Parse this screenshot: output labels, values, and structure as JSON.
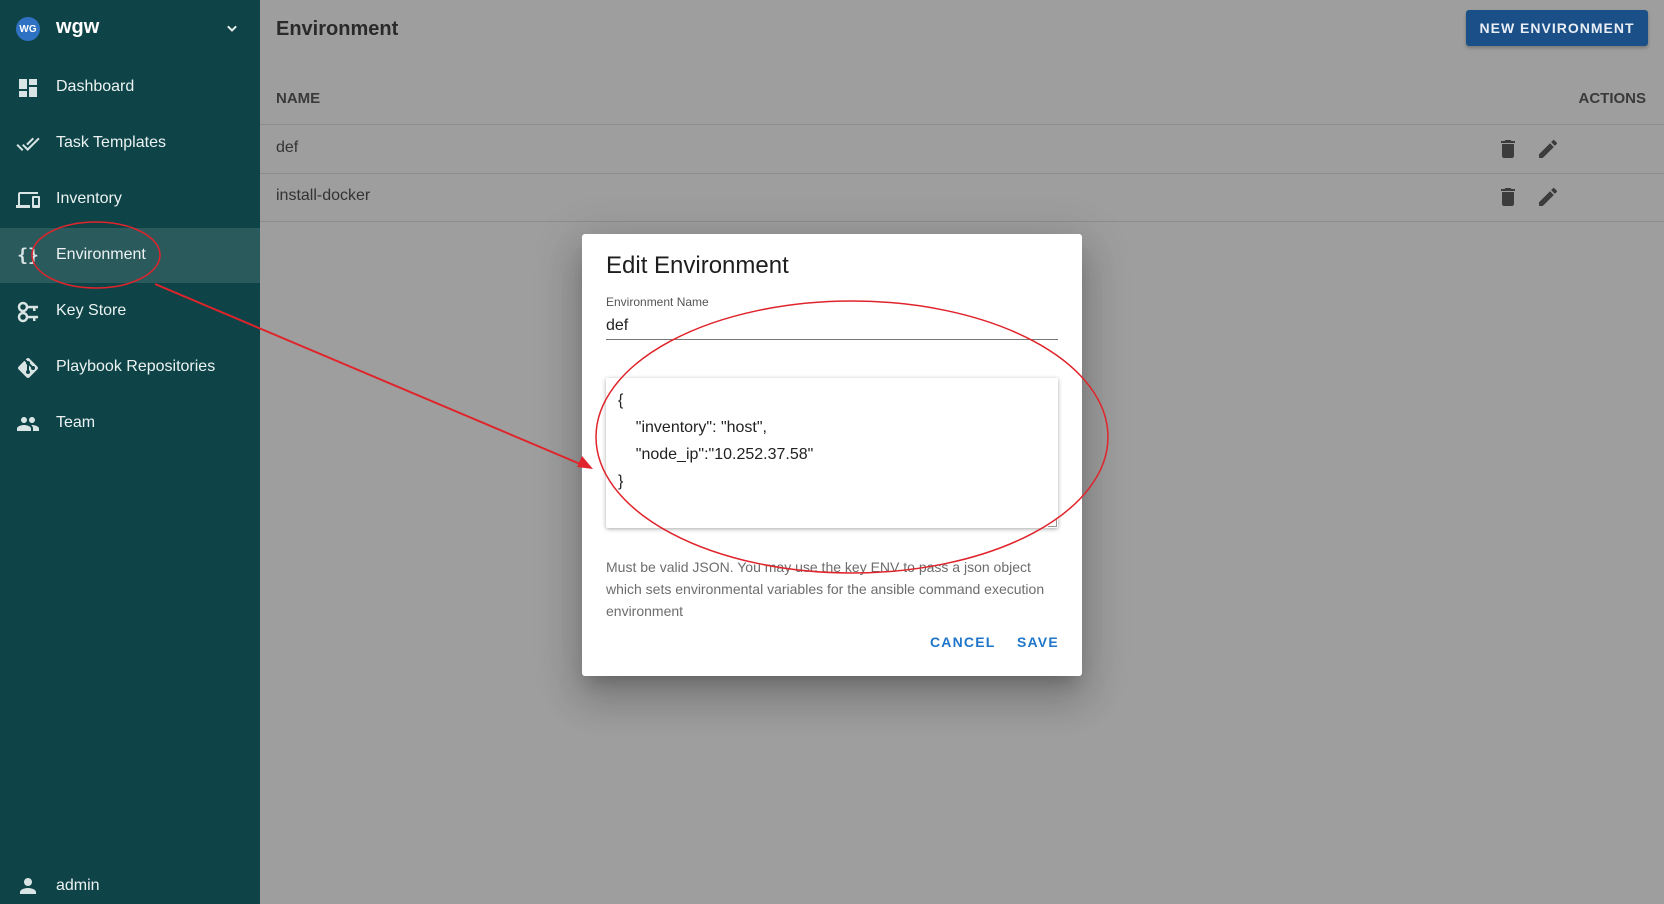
{
  "sidebar": {
    "project": {
      "avatar_text": "WG",
      "name": "wgw"
    },
    "items": [
      {
        "label": "Dashboard",
        "icon": "dashboard-icon"
      },
      {
        "label": "Task Templates",
        "icon": "double-check-icon"
      },
      {
        "label": "Inventory",
        "icon": "monitor-icon"
      },
      {
        "label": "Environment",
        "icon": "braces-icon",
        "active": true
      },
      {
        "label": "Key Store",
        "icon": "key-icon"
      },
      {
        "label": "Playbook Repositories",
        "icon": "git-icon"
      },
      {
        "label": "Team",
        "icon": "people-icon"
      }
    ],
    "user": {
      "label": "admin",
      "icon": "person-icon"
    }
  },
  "header": {
    "title": "Environment",
    "new_button": "NEW ENVIRONMENT"
  },
  "table": {
    "columns": [
      "NAME",
      "ACTIONS"
    ],
    "rows": [
      {
        "name": "def"
      },
      {
        "name": "install-docker"
      }
    ]
  },
  "dialog": {
    "title": "Edit Environment",
    "name_label": "Environment Name",
    "name_value": "def",
    "json_lines": [
      "{",
      "    \"inventory\": \"host\",",
      "    \"node_ip\":\"10.252.37.58\"",
      "}"
    ],
    "hint": "Must be valid JSON. You may use the key ENV to pass a json object which sets environmental variables for the ansible command execution environment",
    "cancel": "CANCEL",
    "save": "SAVE"
  },
  "colors": {
    "sidebar_bg": "#0e4447",
    "sidebar_active": "#2b5a5d",
    "primary_button": "#1b4f87",
    "dialog_action": "#1f76c9",
    "annotation": "#e0242b"
  }
}
